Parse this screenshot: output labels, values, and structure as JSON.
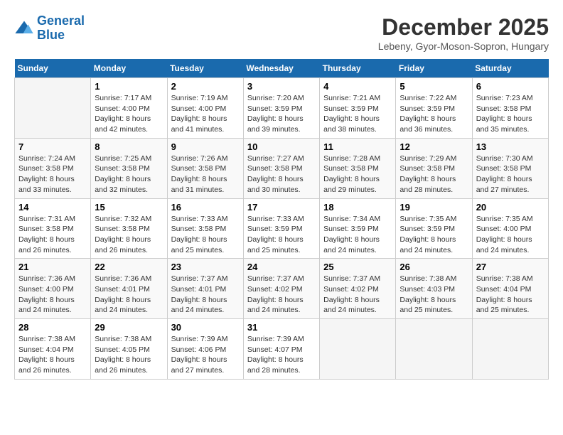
{
  "logo": {
    "line1": "General",
    "line2": "Blue"
  },
  "title": "December 2025",
  "subtitle": "Lebeny, Gyor-Moson-Sopron, Hungary",
  "days_of_week": [
    "Sunday",
    "Monday",
    "Tuesday",
    "Wednesday",
    "Thursday",
    "Friday",
    "Saturday"
  ],
  "weeks": [
    [
      {
        "day": "",
        "info": ""
      },
      {
        "day": "1",
        "info": "Sunrise: 7:17 AM\nSunset: 4:00 PM\nDaylight: 8 hours\nand 42 minutes."
      },
      {
        "day": "2",
        "info": "Sunrise: 7:19 AM\nSunset: 4:00 PM\nDaylight: 8 hours\nand 41 minutes."
      },
      {
        "day": "3",
        "info": "Sunrise: 7:20 AM\nSunset: 3:59 PM\nDaylight: 8 hours\nand 39 minutes."
      },
      {
        "day": "4",
        "info": "Sunrise: 7:21 AM\nSunset: 3:59 PM\nDaylight: 8 hours\nand 38 minutes."
      },
      {
        "day": "5",
        "info": "Sunrise: 7:22 AM\nSunset: 3:59 PM\nDaylight: 8 hours\nand 36 minutes."
      },
      {
        "day": "6",
        "info": "Sunrise: 7:23 AM\nSunset: 3:58 PM\nDaylight: 8 hours\nand 35 minutes."
      }
    ],
    [
      {
        "day": "7",
        "info": "Sunrise: 7:24 AM\nSunset: 3:58 PM\nDaylight: 8 hours\nand 33 minutes."
      },
      {
        "day": "8",
        "info": "Sunrise: 7:25 AM\nSunset: 3:58 PM\nDaylight: 8 hours\nand 32 minutes."
      },
      {
        "day": "9",
        "info": "Sunrise: 7:26 AM\nSunset: 3:58 PM\nDaylight: 8 hours\nand 31 minutes."
      },
      {
        "day": "10",
        "info": "Sunrise: 7:27 AM\nSunset: 3:58 PM\nDaylight: 8 hours\nand 30 minutes."
      },
      {
        "day": "11",
        "info": "Sunrise: 7:28 AM\nSunset: 3:58 PM\nDaylight: 8 hours\nand 29 minutes."
      },
      {
        "day": "12",
        "info": "Sunrise: 7:29 AM\nSunset: 3:58 PM\nDaylight: 8 hours\nand 28 minutes."
      },
      {
        "day": "13",
        "info": "Sunrise: 7:30 AM\nSunset: 3:58 PM\nDaylight: 8 hours\nand 27 minutes."
      }
    ],
    [
      {
        "day": "14",
        "info": "Sunrise: 7:31 AM\nSunset: 3:58 PM\nDaylight: 8 hours\nand 26 minutes."
      },
      {
        "day": "15",
        "info": "Sunrise: 7:32 AM\nSunset: 3:58 PM\nDaylight: 8 hours\nand 26 minutes."
      },
      {
        "day": "16",
        "info": "Sunrise: 7:33 AM\nSunset: 3:58 PM\nDaylight: 8 hours\nand 25 minutes."
      },
      {
        "day": "17",
        "info": "Sunrise: 7:33 AM\nSunset: 3:59 PM\nDaylight: 8 hours\nand 25 minutes."
      },
      {
        "day": "18",
        "info": "Sunrise: 7:34 AM\nSunset: 3:59 PM\nDaylight: 8 hours\nand 24 minutes."
      },
      {
        "day": "19",
        "info": "Sunrise: 7:35 AM\nSunset: 3:59 PM\nDaylight: 8 hours\nand 24 minutes."
      },
      {
        "day": "20",
        "info": "Sunrise: 7:35 AM\nSunset: 4:00 PM\nDaylight: 8 hours\nand 24 minutes."
      }
    ],
    [
      {
        "day": "21",
        "info": "Sunrise: 7:36 AM\nSunset: 4:00 PM\nDaylight: 8 hours\nand 24 minutes."
      },
      {
        "day": "22",
        "info": "Sunrise: 7:36 AM\nSunset: 4:01 PM\nDaylight: 8 hours\nand 24 minutes."
      },
      {
        "day": "23",
        "info": "Sunrise: 7:37 AM\nSunset: 4:01 PM\nDaylight: 8 hours\nand 24 minutes."
      },
      {
        "day": "24",
        "info": "Sunrise: 7:37 AM\nSunset: 4:02 PM\nDaylight: 8 hours\nand 24 minutes."
      },
      {
        "day": "25",
        "info": "Sunrise: 7:37 AM\nSunset: 4:02 PM\nDaylight: 8 hours\nand 24 minutes."
      },
      {
        "day": "26",
        "info": "Sunrise: 7:38 AM\nSunset: 4:03 PM\nDaylight: 8 hours\nand 25 minutes."
      },
      {
        "day": "27",
        "info": "Sunrise: 7:38 AM\nSunset: 4:04 PM\nDaylight: 8 hours\nand 25 minutes."
      }
    ],
    [
      {
        "day": "28",
        "info": "Sunrise: 7:38 AM\nSunset: 4:04 PM\nDaylight: 8 hours\nand 26 minutes."
      },
      {
        "day": "29",
        "info": "Sunrise: 7:38 AM\nSunset: 4:05 PM\nDaylight: 8 hours\nand 26 minutes."
      },
      {
        "day": "30",
        "info": "Sunrise: 7:39 AM\nSunset: 4:06 PM\nDaylight: 8 hours\nand 27 minutes."
      },
      {
        "day": "31",
        "info": "Sunrise: 7:39 AM\nSunset: 4:07 PM\nDaylight: 8 hours\nand 28 minutes."
      },
      {
        "day": "",
        "info": ""
      },
      {
        "day": "",
        "info": ""
      },
      {
        "day": "",
        "info": ""
      }
    ]
  ]
}
